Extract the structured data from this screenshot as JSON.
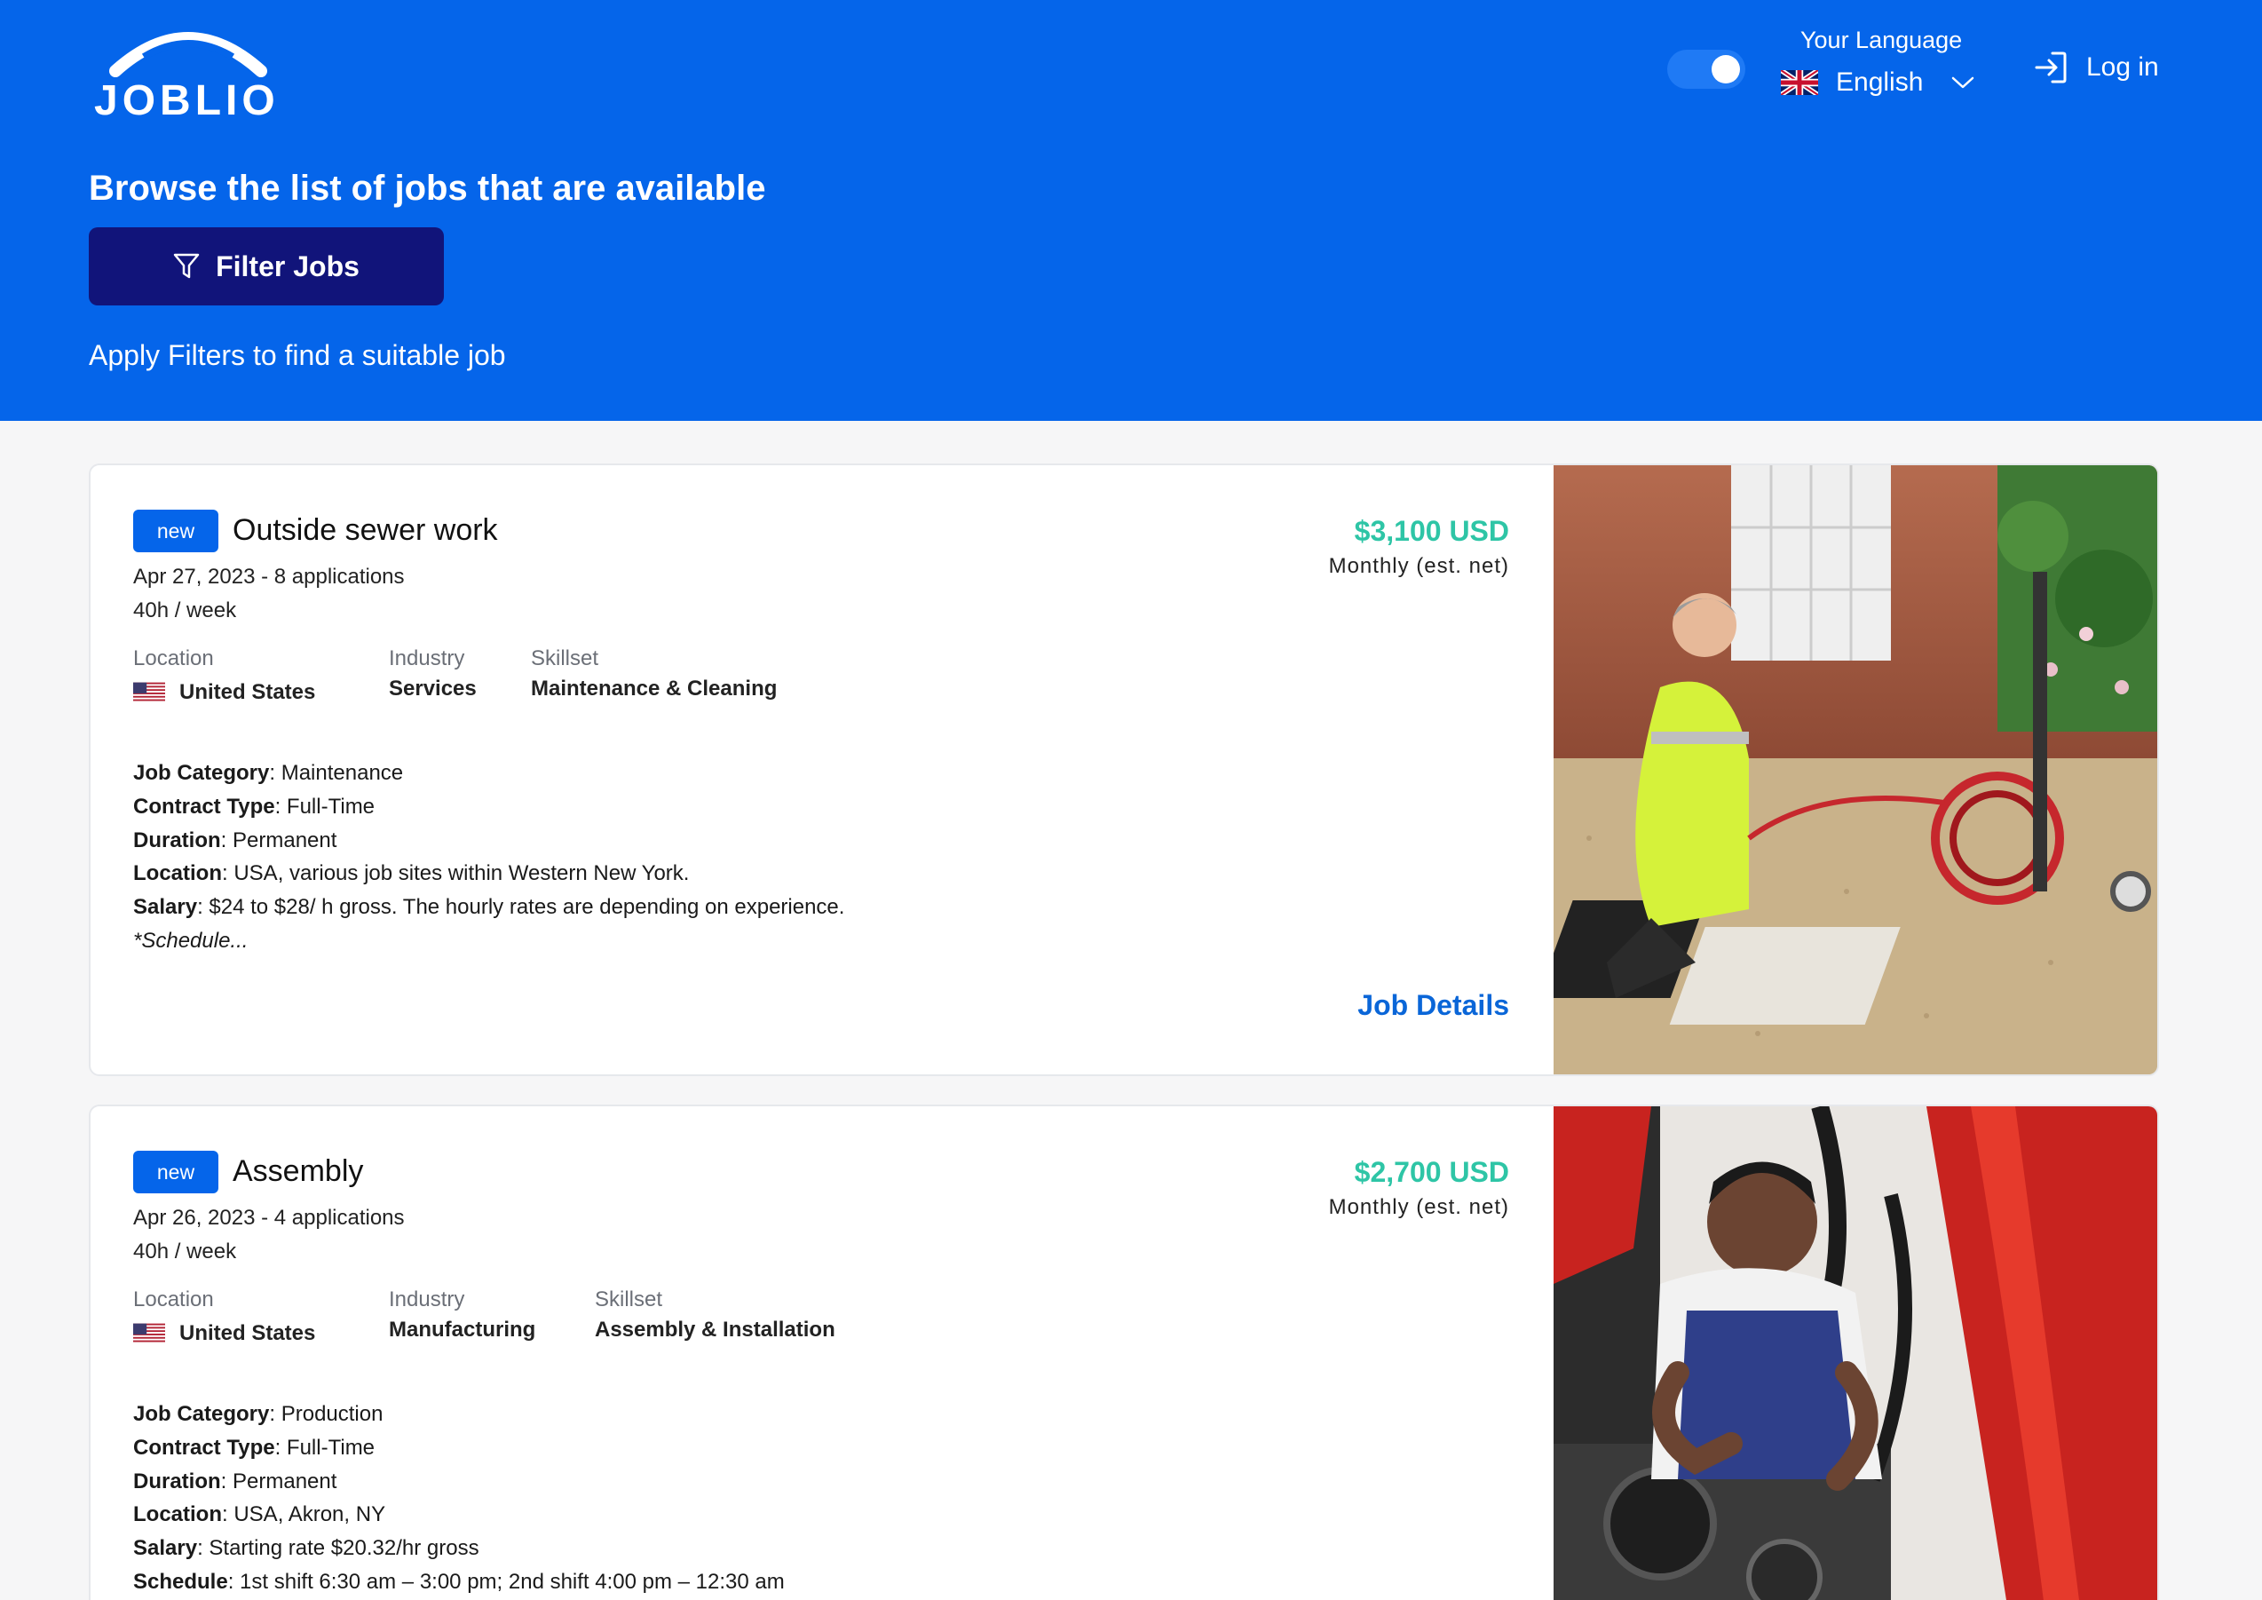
{
  "header": {
    "logo_text": "JOBLIO",
    "language_label": "Your Language",
    "language_value": "English",
    "login_label": "Log in",
    "title": "Browse the list of jobs that are available",
    "filter_button": "Filter Jobs",
    "filter_hint": "Apply Filters to find a suitable job",
    "toggle_on": true
  },
  "labels": {
    "location": "Location",
    "industry": "Industry",
    "skillset": "Skillset",
    "job_category": "Job Category",
    "contract_type": "Contract Type",
    "duration": "Duration",
    "location_detail": "Location",
    "salary": "Salary",
    "schedule": "Schedule",
    "job_details": "Job Details"
  },
  "jobs": [
    {
      "badge": "new",
      "title": "Outside sewer work",
      "meta": "Apr 27, 2023 - 8 applications",
      "hours": "40h  /  week",
      "location": "United States",
      "industry": "Services",
      "skillset": "Maintenance & Cleaning",
      "job_category": "Maintenance",
      "contract_type": "Full-Time",
      "duration": "Permanent",
      "location_detail": "USA, various job sites within Western New York.",
      "salary_detail": "$24 to $28/ h gross. The hourly rates are depending on experience.",
      "schedule_snippet": "*Schedule...",
      "salary": "$3,100 USD",
      "salary_note": "Monthly (est. net)"
    },
    {
      "badge": "new",
      "title": "Assembly",
      "meta": "Apr 26, 2023 - 4 applications",
      "hours": "40h  /  week",
      "location": "United States",
      "industry": "Manufacturing",
      "skillset": "Assembly & Installation",
      "job_category": "Production",
      "contract_type": "Full-Time",
      "duration": "Permanent",
      "location_detail": "USA, Akron, NY",
      "salary_detail": "Starting rate $20.32/hr gross",
      "schedule_detail": "1st shift 6:30 am – 3:00 pm; 2nd shift 4:00 pm – 12:30 am",
      "salary": "$2,700 USD",
      "salary_note": "Monthly (est. net)"
    }
  ],
  "colors": {
    "header_bg": "#0565ea",
    "filter_button_bg": "#11147a",
    "salary": "#2ec5a6",
    "link": "#0a66d8",
    "badge_bg": "#0565ea"
  },
  "icons": {
    "filter": "funnel-icon",
    "login": "login-arrow-icon",
    "language_flag": "uk-flag-icon",
    "location_flag": "us-flag-icon",
    "chevron": "chevron-down-icon"
  }
}
